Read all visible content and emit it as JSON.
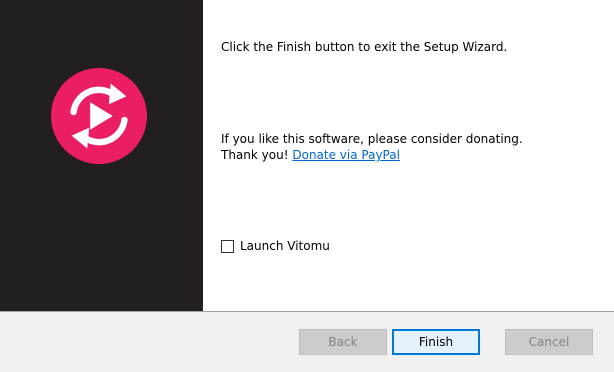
{
  "wizard": {
    "finish_message": "Click the Finish button to exit the Setup Wizard.",
    "donate_line1": "If you like this software, please consider donating.",
    "donate_line2_prefix": "Thank you!",
    "donate_link": "Donate via PayPal",
    "launch_label": "Launch Vitomu",
    "launch_checked": false
  },
  "buttons": {
    "back": "Back",
    "finish": "Finish",
    "cancel": "Cancel"
  },
  "colors": {
    "logo_accent": "#ec1e63",
    "left_panel": "#231f20",
    "link": "#0066cc",
    "focus_border": "#0078d7"
  },
  "icons": {
    "logo": "vitomu-logo-icon"
  }
}
